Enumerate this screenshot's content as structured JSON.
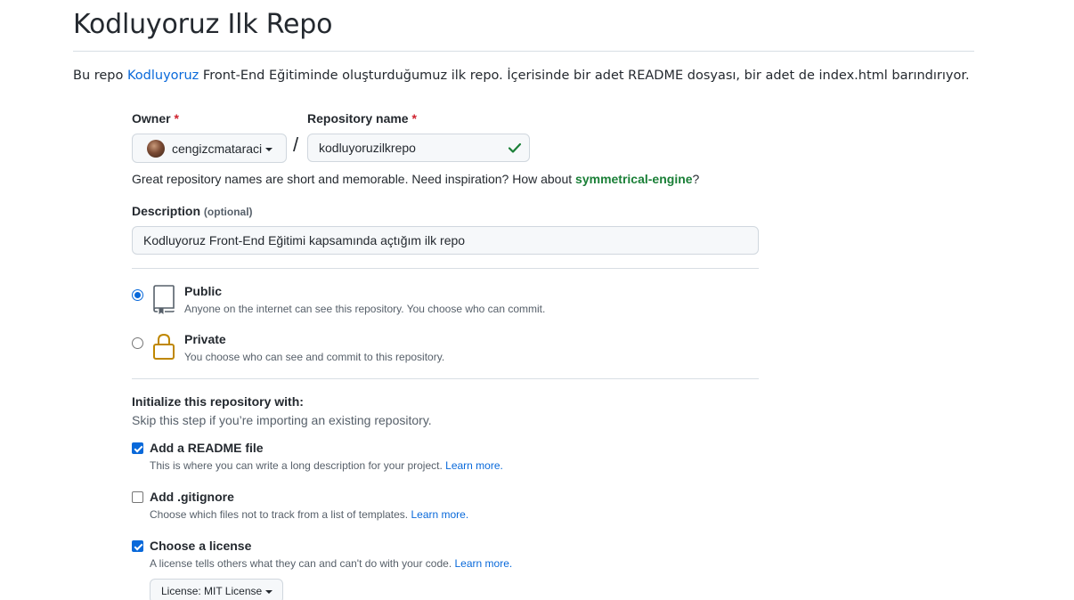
{
  "page": {
    "title": "Kodluyoruz Ilk Repo",
    "intro_before": "Bu repo ",
    "intro_link": "Kodluyoruz",
    "intro_after": " Front-End Eğitiminde oluşturduğumuz ilk repo. İçerisinde bir adet README dosyası, bir adet de index.html barındırıyor."
  },
  "form": {
    "owner_label": "Owner",
    "owner_required": "*",
    "owner_value": "cengizcmataraci",
    "separator": "/",
    "repo_label": "Repository name",
    "repo_required": "*",
    "repo_value": "kodluyoruzilkrepo",
    "repo_status": "check-icon",
    "hint_before": "Great repository names are short and memorable. Need inspiration? How about ",
    "hint_suggestion": "symmetrical-engine",
    "hint_after": "?",
    "description_label": "Description",
    "description_optional": "(optional)",
    "description_value": "Kodluyoruz Front-End Eğitimi kapsamında açtığım ilk repo"
  },
  "visibility": {
    "selected": "public",
    "options": [
      {
        "title": "Public",
        "desc": "Anyone on the internet can see this repository. You choose who can commit.",
        "icon": "repo-icon"
      },
      {
        "title": "Private",
        "desc": "You choose who can see and commit to this repository.",
        "icon": "lock-icon"
      }
    ]
  },
  "init": {
    "title": "Initialize this repository with:",
    "subtitle": "Skip this step if you’re importing an existing repository.",
    "options": [
      {
        "title": "Add a README file",
        "desc": "This is where you can write a long description for your project. ",
        "link": "Learn more.",
        "checked": true
      },
      {
        "title": "Add .gitignore",
        "desc": "Choose which files not to track from a list of templates. ",
        "link": "Learn more.",
        "checked": false
      },
      {
        "title": "Choose a license",
        "desc": "A license tells others what they can and can't do with your code. ",
        "link": "Learn more.",
        "checked": true
      }
    ],
    "license_button": "License: MIT License"
  },
  "colors": {
    "link": "#0969da",
    "success": "#1a7f37",
    "required": "#cf222e",
    "private_icon": "#bf8700"
  }
}
